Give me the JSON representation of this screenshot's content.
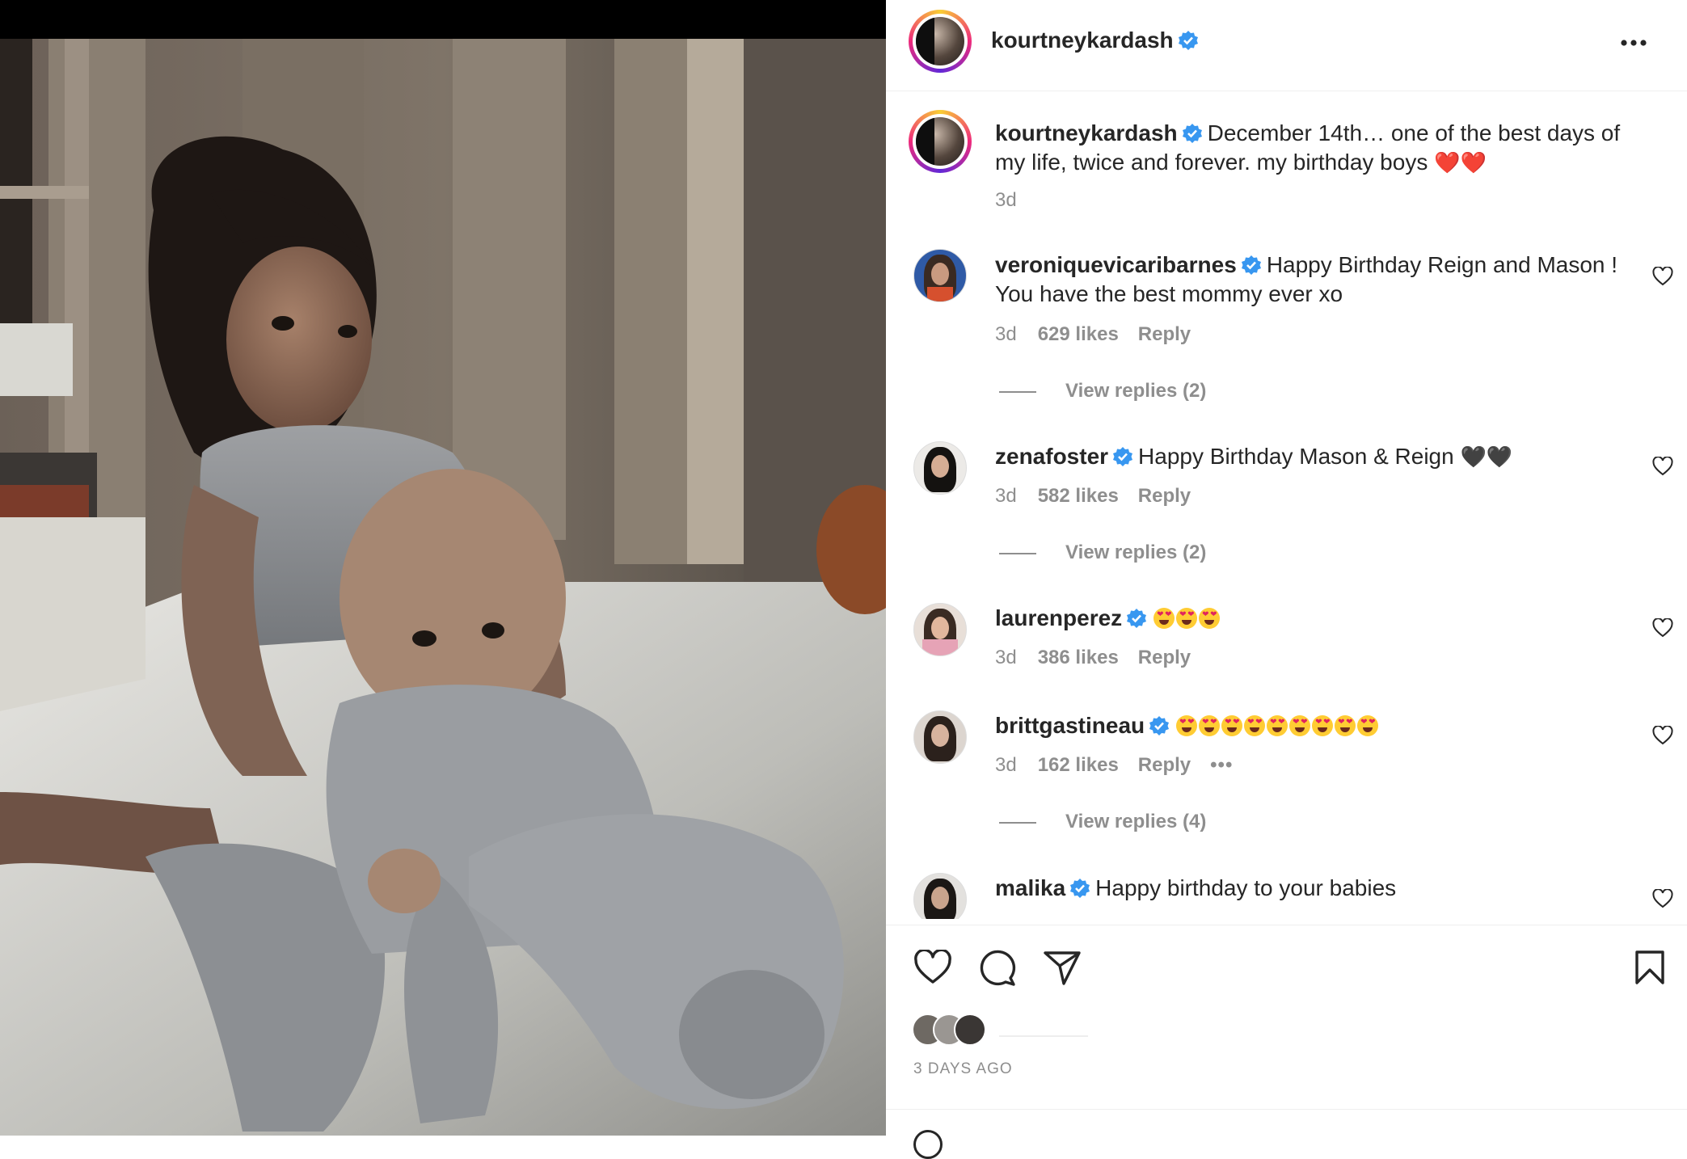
{
  "post": {
    "username": "kourtneykardash",
    "more_icon": "more-horizontal-icon",
    "caption": {
      "username": "kourtneykardash",
      "text": "December 14th… one of the best days of my life, twice and forever. my birthday boys",
      "emoji": "❤️❤️",
      "time": "3d"
    },
    "comments": [
      {
        "username": "veroniquevicaribarnes",
        "text": "Happy Birthday Reign and Mason ! You have the best mommy ever xo",
        "emoji": "",
        "time": "3d",
        "likes": "629 likes",
        "reply": "Reply",
        "view_replies": "View replies (2)"
      },
      {
        "username": "zenafoster",
        "text": "Happy Birthday Mason & Reign",
        "emoji": "🖤🖤",
        "time": "3d",
        "likes": "582 likes",
        "reply": "Reply",
        "view_replies": "View replies (2)"
      },
      {
        "username": "laurenperez",
        "text": "",
        "emoji": "😍😍😍",
        "time": "3d",
        "likes": "386 likes",
        "reply": "Reply",
        "view_replies": ""
      },
      {
        "username": "brittgastineau",
        "text": "",
        "emoji": "😍😍😍😍😍😍😍😍😍",
        "time": "3d",
        "likes": "162 likes",
        "reply": "Reply",
        "more": "•••",
        "view_replies": "View replies (4)"
      },
      {
        "username": "malika",
        "text": "Happy birthday to your babies",
        "emoji": "",
        "time": "",
        "likes": "",
        "reply": "",
        "view_replies": ""
      }
    ],
    "actions": [
      "heart-icon",
      "comment-icon",
      "share-icon",
      "bookmark-icon"
    ],
    "posted_ago": "3 DAYS AGO"
  },
  "colors": {
    "verified": "#3897f0",
    "text": "#262626",
    "muted": "#8e8e8e",
    "divider": "#efefef"
  }
}
